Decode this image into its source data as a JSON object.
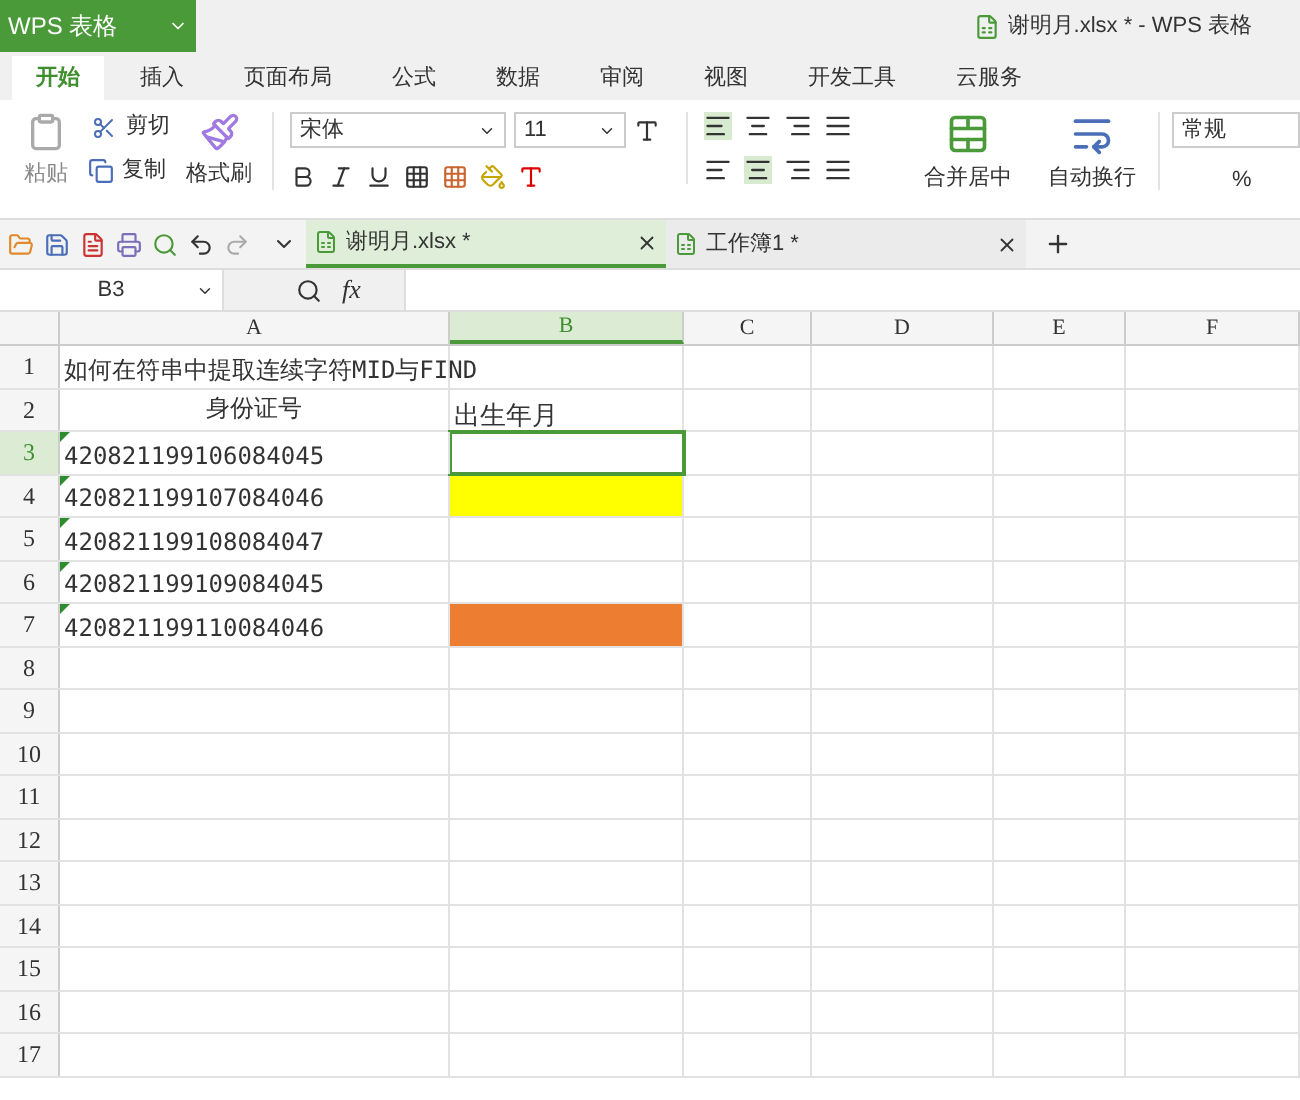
{
  "app_menu": {
    "label": "WPS 表格"
  },
  "window": {
    "title": "谢明月.xlsx * - WPS 表格"
  },
  "ribbon_tabs": [
    {
      "label": "开始",
      "selected": true
    },
    {
      "label": "插入",
      "selected": false
    },
    {
      "label": "页面布局",
      "selected": false
    },
    {
      "label": "公式",
      "selected": false
    },
    {
      "label": "数据",
      "selected": false
    },
    {
      "label": "审阅",
      "selected": false
    },
    {
      "label": "视图",
      "selected": false
    },
    {
      "label": "开发工具",
      "selected": false
    },
    {
      "label": "云服务",
      "selected": false
    }
  ],
  "ribbon": {
    "paste": "粘贴",
    "cut": "剪切",
    "copy": "复制",
    "format_painter": "格式刷",
    "font": "宋体",
    "font_size": "11",
    "merge": "合并居中",
    "wrap": "自动换行",
    "number_format": "常规",
    "percent": "%"
  },
  "doc_tabs": [
    {
      "label": "谢明月.xlsx *",
      "selected": true
    },
    {
      "label": "工作簿1 *",
      "selected": false
    }
  ],
  "formula_bar": {
    "cell_ref": "B3",
    "fx": "fx"
  },
  "columns": [
    {
      "label": "A",
      "selected": false
    },
    {
      "label": "B",
      "selected": true
    },
    {
      "label": "C",
      "selected": false
    },
    {
      "label": "D",
      "selected": false
    },
    {
      "label": "E",
      "selected": false
    },
    {
      "label": "F",
      "selected": false
    }
  ],
  "rows": [
    {
      "number": "1",
      "selected": false,
      "kind": "title",
      "a": {
        "text": "如何在符串中提取连续字符MID与FIND",
        "flag": false
      },
      "b": {
        "selected": false
      }
    },
    {
      "number": "2",
      "selected": false,
      "kind": "header",
      "a": {
        "text": "身份证号",
        "flag": false
      },
      "b": {
        "text": "出生年月",
        "selected": false
      }
    },
    {
      "number": "3",
      "selected": true,
      "kind": "data",
      "a": {
        "text": "420821199106084045",
        "flag": true
      },
      "b": {
        "selected": true
      }
    },
    {
      "number": "4",
      "selected": false,
      "kind": "data",
      "a": {
        "text": "420821199107084046",
        "flag": true
      },
      "b": {
        "selected": false,
        "color": "#ffff00"
      }
    },
    {
      "number": "5",
      "selected": false,
      "kind": "data",
      "a": {
        "text": "420821199108084047",
        "flag": true
      },
      "b": {
        "selected": false
      }
    },
    {
      "number": "6",
      "selected": false,
      "kind": "data",
      "a": {
        "text": "420821199109084045",
        "flag": true
      },
      "b": {
        "selected": false
      }
    },
    {
      "number": "7",
      "selected": false,
      "kind": "data",
      "a": {
        "text": "420821199110084046",
        "flag": true
      },
      "b": {
        "selected": false,
        "color": "#ed7d31"
      }
    },
    {
      "number": "8",
      "selected": false
    },
    {
      "number": "9",
      "selected": false
    },
    {
      "number": "10",
      "selected": false
    },
    {
      "number": "11",
      "selected": false
    },
    {
      "number": "12",
      "selected": false
    },
    {
      "number": "13",
      "selected": false
    },
    {
      "number": "14",
      "selected": false
    },
    {
      "number": "15",
      "selected": false
    },
    {
      "number": "16",
      "selected": false
    },
    {
      "number": "17",
      "selected": false
    }
  ]
}
